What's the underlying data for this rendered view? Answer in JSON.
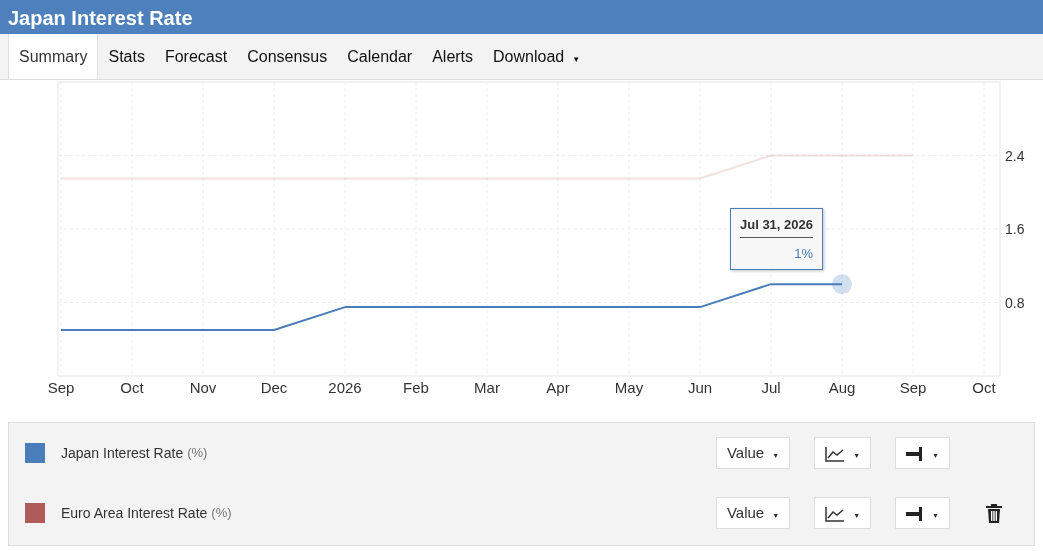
{
  "header": {
    "title": "Japan Interest Rate"
  },
  "tabs": [
    {
      "label": "Summary",
      "selected": true
    },
    {
      "label": "Stats",
      "selected": false
    },
    {
      "label": "Forecast",
      "selected": false
    },
    {
      "label": "Consensus",
      "selected": false
    },
    {
      "label": "Calendar",
      "selected": false
    },
    {
      "label": "Alerts",
      "selected": false
    },
    {
      "label": "Download",
      "selected": false,
      "caret": "▼"
    }
  ],
  "chart": {
    "chart_data": {
      "type": "line",
      "grid": true,
      "categories": [
        "Sep",
        "Oct",
        "Nov",
        "Dec",
        "2026",
        "Feb",
        "Mar",
        "Apr",
        "May",
        "Jun",
        "Jul",
        "Aug",
        "Sep",
        "Oct"
      ],
      "ylim": [
        0,
        3.2
      ],
      "yticks": [
        0.8,
        1.6,
        2.4
      ],
      "series": [
        {
          "name": "Japan Interest Rate",
          "color": "#4a7ebb",
          "values": [
            0.5,
            0.5,
            0.5,
            0.5,
            0.75,
            0.75,
            0.75,
            0.75,
            0.75,
            0.75,
            1,
            1,
            null,
            null
          ]
        },
        {
          "name": "Euro Area Interest Rate",
          "color": "#b05a5a",
          "values": [
            2.15,
            2.15,
            2.15,
            2.15,
            2.15,
            2.15,
            2.15,
            2.15,
            2.15,
            2.15,
            2.4,
            2.4,
            2.4,
            null
          ]
        }
      ]
    },
    "tooltip": {
      "date": "Jul 31, 2026",
      "value": "1%"
    }
  },
  "legend": [
    {
      "unit": "(%)",
      "hovered": true,
      "deletable": false,
      "controls": [
        {
          "kind": "value",
          "label": "Value",
          "caret": "▼"
        },
        {
          "kind": "chart-type",
          "caret": "▼"
        },
        {
          "kind": "axis",
          "caret": "▼"
        }
      ]
    },
    {
      "unit": "(%)",
      "hovered": false,
      "deletable": true,
      "controls": [
        {
          "kind": "value",
          "label": "Value",
          "caret": "▼"
        },
        {
          "kind": "chart-type",
          "caret": "▼"
        },
        {
          "kind": "axis",
          "caret": "▼"
        }
      ]
    }
  ]
}
